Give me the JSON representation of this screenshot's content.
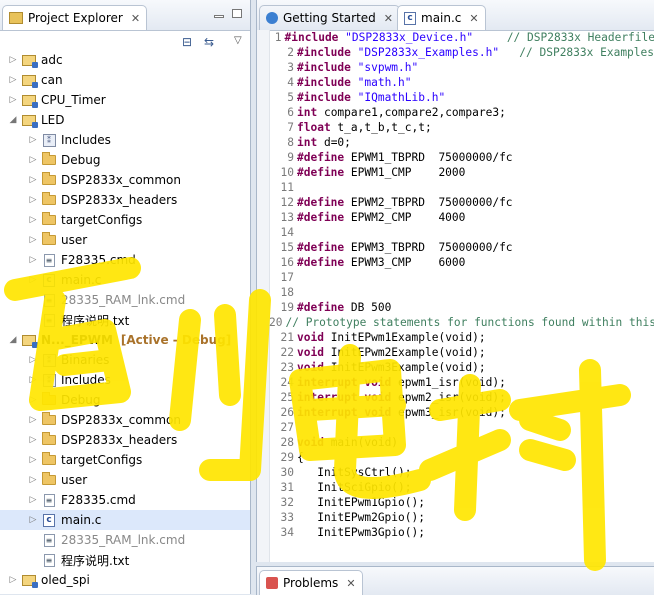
{
  "explorer": {
    "tab_label": "Project Explorer",
    "close": "✕",
    "tree": [
      {
        "label": "adc",
        "indent": 0,
        "twisty": "▷",
        "icon": "proj"
      },
      {
        "label": "can",
        "indent": 0,
        "twisty": "▷",
        "icon": "proj"
      },
      {
        "label": "CPU_Timer",
        "indent": 0,
        "twisty": "▷",
        "icon": "proj"
      },
      {
        "label": "LED",
        "indent": 0,
        "twisty": "◢",
        "icon": "proj"
      },
      {
        "label": "Includes",
        "indent": 1,
        "twisty": "▷",
        "icon": "inc"
      },
      {
        "label": "Debug",
        "indent": 1,
        "twisty": "▷",
        "icon": "fold"
      },
      {
        "label": "DSP2833x_common",
        "indent": 1,
        "twisty": "▷",
        "icon": "fold"
      },
      {
        "label": "DSP2833x_headers",
        "indent": 1,
        "twisty": "▷",
        "icon": "fold"
      },
      {
        "label": "targetConfigs",
        "indent": 1,
        "twisty": "▷",
        "icon": "fold"
      },
      {
        "label": "user",
        "indent": 1,
        "twisty": "▷",
        "icon": "fold"
      },
      {
        "label": "F28335.cmd",
        "indent": 1,
        "twisty": "▷",
        "icon": "file"
      },
      {
        "label": "main.c",
        "indent": 1,
        "twisty": "▷",
        "icon": "cfile"
      },
      {
        "label": "28335_RAM_lnk.cmd",
        "indent": 1,
        "twisty": "",
        "icon": "file",
        "grey": true
      },
      {
        "label": "程序说明.txt",
        "indent": 1,
        "twisty": "",
        "icon": "file"
      },
      {
        "label": "N..._EPWM",
        "indent": 0,
        "twisty": "◢",
        "icon": "proj",
        "active": "[Active - Debug]"
      },
      {
        "label": "Binaries",
        "indent": 1,
        "twisty": "▷",
        "icon": "inc"
      },
      {
        "label": "Includes",
        "indent": 1,
        "twisty": "▷",
        "icon": "inc"
      },
      {
        "label": "Debug",
        "indent": 1,
        "twisty": "▷",
        "icon": "fold"
      },
      {
        "label": "DSP2833x_common",
        "indent": 1,
        "twisty": "▷",
        "icon": "fold"
      },
      {
        "label": "DSP2833x_headers",
        "indent": 1,
        "twisty": "▷",
        "icon": "fold"
      },
      {
        "label": "targetConfigs",
        "indent": 1,
        "twisty": "▷",
        "icon": "fold"
      },
      {
        "label": "user",
        "indent": 1,
        "twisty": "▷",
        "icon": "fold"
      },
      {
        "label": "F28335.cmd",
        "indent": 1,
        "twisty": "▷",
        "icon": "file"
      },
      {
        "label": "main.c",
        "indent": 1,
        "twisty": "▷",
        "icon": "cfile",
        "selected": true
      },
      {
        "label": "28335_RAM_lnk.cmd",
        "indent": 1,
        "twisty": "",
        "icon": "file",
        "grey": true
      },
      {
        "label": "程序说明.txt",
        "indent": 1,
        "twisty": "",
        "icon": "file"
      },
      {
        "label": "oled_spi",
        "indent": 0,
        "twisty": "▷",
        "icon": "proj"
      }
    ]
  },
  "editor": {
    "tabs": [
      {
        "label": "Getting Started",
        "active": false
      },
      {
        "label": "main.c",
        "active": true
      }
    ],
    "close": "✕",
    "lines": [
      {
        "n": "1",
        "parts": [
          [
            "kw",
            "#include "
          ],
          [
            "str",
            "\"DSP2833x_Device.h\""
          ],
          [
            "cm",
            "     // DSP2833x Headerfile"
          ]
        ]
      },
      {
        "n": "2",
        "parts": [
          [
            "kw",
            "#include "
          ],
          [
            "str",
            "\"DSP2833x_Examples.h\""
          ],
          [
            "cm",
            "   // DSP2833x Examples"
          ]
        ]
      },
      {
        "n": "3",
        "parts": [
          [
            "kw",
            "#include "
          ],
          [
            "str",
            "\"svpwm.h\""
          ]
        ]
      },
      {
        "n": "4",
        "parts": [
          [
            "kw",
            "#include "
          ],
          [
            "str",
            "\"math.h\""
          ]
        ]
      },
      {
        "n": "5",
        "parts": [
          [
            "kw",
            "#include "
          ],
          [
            "str",
            "\"IQmathLib.h\""
          ]
        ]
      },
      {
        "n": "6",
        "parts": [
          [
            "kw",
            "int "
          ],
          [
            "mac",
            "compare1,compare2,compare3;"
          ]
        ]
      },
      {
        "n": "7",
        "parts": [
          [
            "kw",
            "float "
          ],
          [
            "mac",
            "t_a,t_b,t_c,t;"
          ]
        ]
      },
      {
        "n": "8",
        "parts": [
          [
            "kw",
            "int "
          ],
          [
            "mac",
            "d=0;"
          ]
        ]
      },
      {
        "n": "9",
        "parts": [
          [
            "kw",
            "#define "
          ],
          [
            "mac",
            "EPWM1_TBPRD  75000000/fc"
          ]
        ]
      },
      {
        "n": "10",
        "parts": [
          [
            "kw",
            "#define "
          ],
          [
            "mac",
            "EPWM1_CMP    2000"
          ]
        ]
      },
      {
        "n": "11",
        "parts": []
      },
      {
        "n": "12",
        "parts": [
          [
            "kw",
            "#define "
          ],
          [
            "mac",
            "EPWM2_TBPRD  75000000/fc"
          ]
        ]
      },
      {
        "n": "13",
        "parts": [
          [
            "kw",
            "#define "
          ],
          [
            "mac",
            "EPWM2_CMP    4000"
          ]
        ]
      },
      {
        "n": "14",
        "parts": []
      },
      {
        "n": "15",
        "parts": [
          [
            "kw",
            "#define "
          ],
          [
            "mac",
            "EPWM3_TBPRD  75000000/fc"
          ]
        ]
      },
      {
        "n": "16",
        "parts": [
          [
            "kw",
            "#define "
          ],
          [
            "mac",
            "EPWM3_CMP    6000"
          ]
        ]
      },
      {
        "n": "17",
        "parts": []
      },
      {
        "n": "18",
        "parts": []
      },
      {
        "n": "19",
        "parts": [
          [
            "kw",
            "#define "
          ],
          [
            "mac",
            "DB 500"
          ]
        ]
      },
      {
        "n": "20",
        "parts": [
          [
            "cm",
            "// Prototype statements for functions found within this file."
          ]
        ]
      },
      {
        "n": "21",
        "parts": [
          [
            "kw",
            "void "
          ],
          [
            "mac",
            "InitEPwm1Example(void);"
          ]
        ]
      },
      {
        "n": "22",
        "parts": [
          [
            "kw",
            "void "
          ],
          [
            "mac",
            "InitEPwm2Example(void);"
          ]
        ]
      },
      {
        "n": "23",
        "parts": [
          [
            "kw",
            "void "
          ],
          [
            "mac",
            "InitEPwm3Example(void);"
          ]
        ]
      },
      {
        "n": "24",
        "parts": [
          [
            "kw",
            "interrupt void "
          ],
          [
            "mac",
            "epwm1_isr(void);"
          ]
        ]
      },
      {
        "n": "25",
        "parts": [
          [
            "kw",
            "interrupt void "
          ],
          [
            "mac",
            "epwm2_isr(void);"
          ]
        ]
      },
      {
        "n": "26",
        "parts": [
          [
            "kw",
            "interrupt void "
          ],
          [
            "mac",
            "epwm3_isr(void);"
          ]
        ]
      },
      {
        "n": "27",
        "parts": []
      },
      {
        "n": "28",
        "parts": [
          [
            "kw",
            "void "
          ],
          [
            "mac",
            "main(void)"
          ]
        ]
      },
      {
        "n": "29",
        "parts": [
          [
            "mac",
            "{"
          ]
        ]
      },
      {
        "n": "30",
        "parts": [
          [
            "mac",
            "   InitSysCtrl();"
          ]
        ]
      },
      {
        "n": "31",
        "parts": [
          [
            "mac",
            "   InitSciGpio();"
          ]
        ]
      },
      {
        "n": "32",
        "parts": [
          [
            "mac",
            "   InitEPwm1Gpio();"
          ]
        ]
      },
      {
        "n": "33",
        "parts": [
          [
            "mac",
            "   InitEPwm2Gpio();"
          ]
        ]
      },
      {
        "n": "34",
        "parts": [
          [
            "mac",
            "   InitEPwm3Gpio();"
          ]
        ]
      }
    ]
  },
  "problems": {
    "tab_label": "Problems"
  },
  "watermark": {
    "text": "百川电科",
    "color": "#ffe600"
  }
}
